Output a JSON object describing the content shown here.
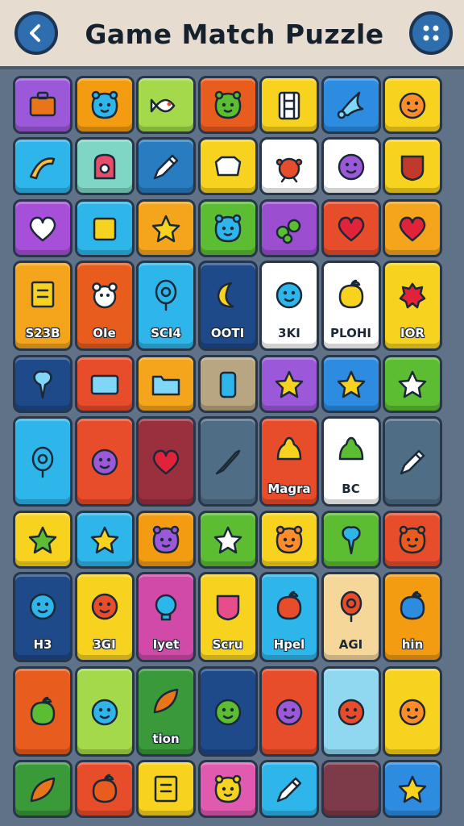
{
  "header": {
    "title": "Game Match Puzzle",
    "back_icon": "chevron-left-icon",
    "menu_icon": "dots-grid-icon"
  },
  "colors": {
    "header_bg": "#e6ddd0",
    "board_bg": "#5f7288",
    "button_blue": "#2f6eae"
  },
  "board": {
    "rows": [
      {
        "tall": false,
        "tiles": [
          {
            "icon": "briefcase",
            "color": "#9b59d9"
          },
          {
            "icon": "critter",
            "color": "#f39c12"
          },
          {
            "icon": "fish",
            "color": "#a3d94b"
          },
          {
            "icon": "critter",
            "color": "#e85d1e"
          },
          {
            "icon": "ladder",
            "color": "#f7d31f"
          },
          {
            "icon": "bird",
            "color": "#2d8be0"
          },
          {
            "icon": "face",
            "color": "#f7d31f"
          }
        ]
      },
      {
        "tall": false,
        "tiles": [
          {
            "icon": "boomerang",
            "color": "#2eb6ea"
          },
          {
            "icon": "bag",
            "color": "#7fd6c4"
          },
          {
            "icon": "pen",
            "color": "#2a7cc0"
          },
          {
            "icon": "gem",
            "color": "#f7d31f"
          },
          {
            "icon": "bug",
            "color": "#ffffff"
          },
          {
            "icon": "face",
            "color": "#ffffff"
          },
          {
            "icon": "shield",
            "color": "#f7d31f"
          }
        ]
      },
      {
        "tall": false,
        "tiles": [
          {
            "icon": "heart",
            "color": "#a64fd8"
          },
          {
            "icon": "square",
            "color": "#2eb6ea"
          },
          {
            "icon": "star",
            "color": "#f5a51c"
          },
          {
            "icon": "critter",
            "color": "#5cbd33"
          },
          {
            "icon": "grapes",
            "color": "#9b4ed0"
          },
          {
            "icon": "heart",
            "color": "#e74c2b"
          },
          {
            "icon": "heart",
            "color": "#f5a51c"
          }
        ]
      },
      {
        "tall": true,
        "tiles": [
          {
            "icon": "note",
            "color": "#f5a51c",
            "label": "S23B"
          },
          {
            "icon": "bear",
            "color": "#e85d1e",
            "label": "OIe"
          },
          {
            "icon": "balloon",
            "color": "#2eb6ea",
            "label": "SCI4"
          },
          {
            "icon": "moon",
            "color": "#1e4a8a",
            "label": "OOTI"
          },
          {
            "icon": "face",
            "color": "#ffffff",
            "label": "3KI"
          },
          {
            "icon": "fruit",
            "color": "#ffffff",
            "label": "PLOHI"
          },
          {
            "icon": "berry",
            "color": "#f7d31f",
            "label": "IOR"
          }
        ]
      },
      {
        "tall": false,
        "tiles": [
          {
            "icon": "pin",
            "color": "#1e4a8a"
          },
          {
            "icon": "screen",
            "color": "#e74c2b"
          },
          {
            "icon": "folder",
            "color": "#f5a51c"
          },
          {
            "icon": "phone",
            "color": "#b8a582"
          },
          {
            "icon": "star",
            "color": "#9b59d9"
          },
          {
            "icon": "star",
            "color": "#2d8be0"
          },
          {
            "icon": "star",
            "color": "#5cbd33"
          }
        ]
      },
      {
        "tall": true,
        "tiles": [
          {
            "icon": "balloon",
            "color": "#2eb6ea"
          },
          {
            "icon": "face",
            "color": "#e74c2b"
          },
          {
            "icon": "heart",
            "color": "#9a2f3e"
          },
          {
            "icon": "dagger",
            "color": "#4f6d84"
          },
          {
            "icon": "bell",
            "color": "#e74c2b",
            "label": "Magra"
          },
          {
            "icon": "bell",
            "color": "#ffffff",
            "label": "BC"
          },
          {
            "icon": "pen",
            "color": "#4f6d84"
          }
        ]
      },
      {
        "tall": false,
        "tiles": [
          {
            "icon": "star",
            "color": "#f7d31f"
          },
          {
            "icon": "star",
            "color": "#2eb6ea"
          },
          {
            "icon": "critter",
            "color": "#f39c12"
          },
          {
            "icon": "star",
            "color": "#5cbd33"
          },
          {
            "icon": "critter",
            "color": "#f7d31f"
          },
          {
            "icon": "pin",
            "color": "#5cbd33"
          },
          {
            "icon": "critter",
            "color": "#e74c2b"
          }
        ]
      },
      {
        "tall": true,
        "tiles": [
          {
            "icon": "face",
            "color": "#1e4a8a",
            "label": "H3"
          },
          {
            "icon": "face",
            "color": "#f7d31f",
            "label": "3GI"
          },
          {
            "icon": "bulb",
            "color": "#d24aa8",
            "label": "Iyet"
          },
          {
            "icon": "shield",
            "color": "#f7d31f",
            "label": "Scru"
          },
          {
            "icon": "fruit",
            "color": "#2eb6ea",
            "label": "Hpel"
          },
          {
            "icon": "balloon",
            "color": "#f6d79a",
            "label": "AGI"
          },
          {
            "icon": "fruit",
            "color": "#f39c12",
            "label": "hin"
          }
        ]
      },
      {
        "tall": true,
        "tiles": [
          {
            "icon": "fruit",
            "color": "#e85d1e"
          },
          {
            "icon": "face",
            "color": "#a3d94b"
          },
          {
            "icon": "leaf",
            "color": "#3a9a3a",
            "label": "tion"
          },
          {
            "icon": "face",
            "color": "#1e4a8a"
          },
          {
            "icon": "face",
            "color": "#e74c2b"
          },
          {
            "icon": "face",
            "color": "#8fd8f0"
          },
          {
            "icon": "face",
            "color": "#f7d31f"
          }
        ]
      },
      {
        "tall": false,
        "tiles": [
          {
            "icon": "leaf",
            "color": "#3a9a3a"
          },
          {
            "icon": "fruit",
            "color": "#e74c2b"
          },
          {
            "icon": "note",
            "color": "#f7d31f"
          },
          {
            "icon": "critter",
            "color": "#e05ab0"
          },
          {
            "icon": "pen",
            "color": "#2eb6ea"
          },
          {
            "icon": "empty",
            "color": "#7d3a48"
          },
          {
            "icon": "star",
            "color": "#2d8be0"
          }
        ]
      }
    ]
  }
}
